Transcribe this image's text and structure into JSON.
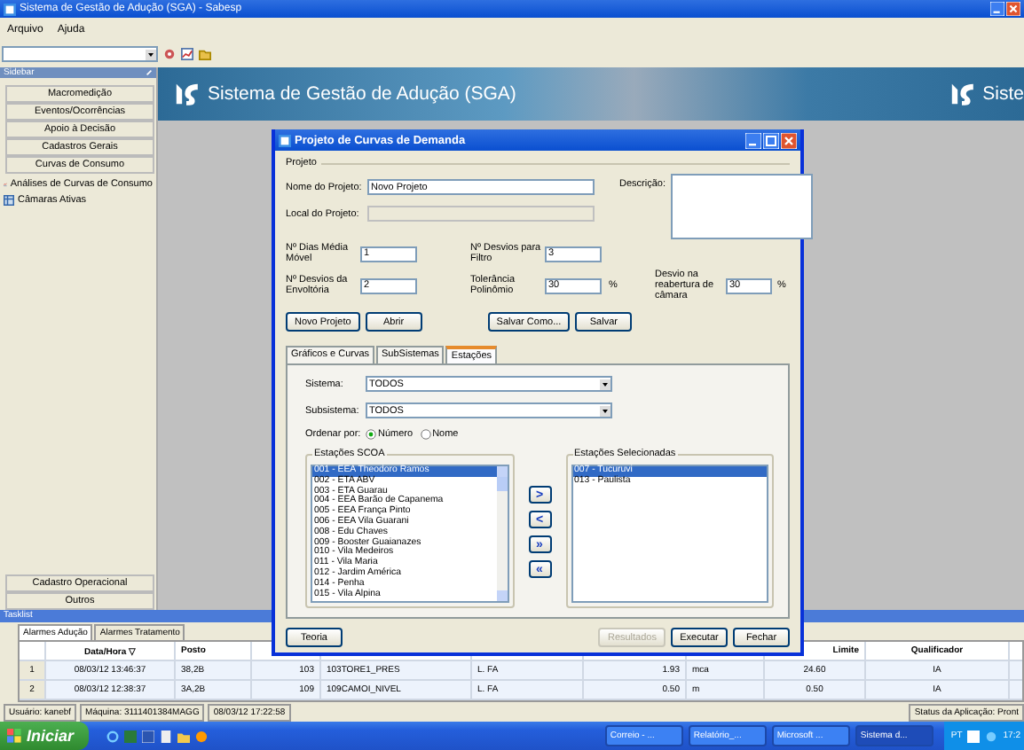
{
  "window": {
    "title": "Sistema de Gestão de Adução (SGA) - Sabesp"
  },
  "menu": [
    "Arquivo",
    "Ajuda"
  ],
  "sidebar": {
    "title": "Sidebar",
    "groups": [
      "Macromedição",
      "Eventos/Ocorrências",
      "Apoio à Decisão",
      "Cadastros Gerais",
      "Curvas de Consumo"
    ],
    "items": [
      {
        "label": "Análises de Curvas de Consumo",
        "kind": "chart"
      },
      {
        "label": "Câmaras Ativas",
        "kind": "table"
      }
    ],
    "bottom_groups": [
      "Cadastro Operacional",
      "Outros"
    ]
  },
  "banner": {
    "title": "Sistema de Gestão de Adução (SGA)",
    "title_repeat": "Siste"
  },
  "dialog": {
    "title": "Projeto de Curvas de Demanda",
    "section": "Projeto",
    "name_label": "Nome do Projeto:",
    "name_value": "Novo Projeto",
    "location_label": "Local do Projeto:",
    "location_disabled": true,
    "description_label": "Descrição:",
    "params": [
      {
        "label": "Nº Dias Média Móvel",
        "value": "1"
      },
      {
        "label": "Nº Desvios para Filtro",
        "value": "3"
      },
      {
        "label": "Nº Desvios da Envoltória",
        "value": "2"
      },
      {
        "label": "Tolerância Polinômio",
        "value": "30",
        "unit": "%"
      },
      {
        "label": "Desvio na reabertura de câmara",
        "value": "30",
        "unit": "%"
      }
    ],
    "project_buttons": [
      "Novo Projeto",
      "Abrir",
      "Salvar Como...",
      "Salvar"
    ],
    "tabs": [
      {
        "label": "Gráficos e Curvas",
        "selected": false
      },
      {
        "label": "SubSistemas",
        "selected": false
      },
      {
        "label": "Estações",
        "selected": true
      }
    ],
    "system_label": "Sistema:",
    "system_value": "TODOS",
    "subsystem_label": "Subsistema:",
    "subsystem_value": "TODOS",
    "sort_label": "Ordenar por:",
    "sort_options": [
      {
        "label": "Número",
        "selected": true
      },
      {
        "label": "Nome",
        "selected": false
      }
    ],
    "available": {
      "title": "Estações SCOA",
      "items": [
        {
          "label": "001 - EEA Theodoro Ramos",
          "selected": true
        },
        {
          "label": "002 - ETA ABV",
          "selected": false
        },
        {
          "label": "003 - ETA Guarau",
          "selected": false
        },
        {
          "label": "004 - EEA Barão de Capanema",
          "selected": false
        },
        {
          "label": "005 - EEA França Pinto",
          "selected": false
        },
        {
          "label": "006 - EEA Vila Guarani",
          "selected": false
        },
        {
          "label": "008 - Edu Chaves",
          "selected": false
        },
        {
          "label": "009 - Booster Guaianazes",
          "selected": false
        },
        {
          "label": "010 - Vila Medeiros",
          "selected": false
        },
        {
          "label": "011 - Vila Maria",
          "selected": false
        },
        {
          "label": "012 - Jardim América",
          "selected": false
        },
        {
          "label": "014 - Penha",
          "selected": false
        },
        {
          "label": "015 - Vila Alpina",
          "selected": false
        }
      ]
    },
    "chosen": {
      "title": "Estações Selecionadas",
      "items": [
        {
          "label": "007 - Tucuruvi",
          "selected": true
        },
        {
          "label": "013 - Paulista",
          "selected": false
        }
      ]
    },
    "move_buttons": [
      ">",
      "<",
      "»",
      "«"
    ],
    "footer_buttons": [
      {
        "label": "Teoria",
        "disabled": false
      },
      {
        "label": "Resultados",
        "disabled": true
      },
      {
        "label": "Executar",
        "disabled": false
      },
      {
        "label": "Fechar",
        "disabled": false
      }
    ]
  },
  "tasklist": {
    "title": "Tasklist",
    "tabs": [
      {
        "label": "Alarmes Adução",
        "selected": true
      },
      {
        "label": "Alarmes Tratamento",
        "selected": false
      }
    ],
    "columns": [
      "",
      "Data/Hora ▽",
      "Posto",
      "",
      "",
      "",
      "",
      "",
      "Limite",
      "Qualificador"
    ],
    "rows": [
      [
        "1",
        "08/03/12 13:46:37",
        "38,2B",
        "103",
        "103TORE1_PRES",
        "L. FA",
        "1.93",
        "mca",
        "24.60",
        "IA"
      ],
      [
        "2",
        "08/03/12 12:38:37",
        "3A,2B",
        "109",
        "109CAMOI_NIVEL",
        "L. FA",
        "0.50",
        "m",
        "0.50",
        "IA"
      ]
    ]
  },
  "status_bar": [
    "Usuário: kanebf",
    "Máquina: 3111401384MAGG",
    "08/03/12 17:22:58",
    "Status da Aplicação: Pront"
  ],
  "taskbar": {
    "start": "Iniciar",
    "tasks": [
      {
        "label": "Correio - ...",
        "selected": false
      },
      {
        "label": "Relatório_...",
        "selected": false
      },
      {
        "label": "Microsoft ...",
        "selected": false
      },
      {
        "label": "Sistema d...",
        "selected": true
      }
    ],
    "language": "PT",
    "clock": "17:2"
  }
}
